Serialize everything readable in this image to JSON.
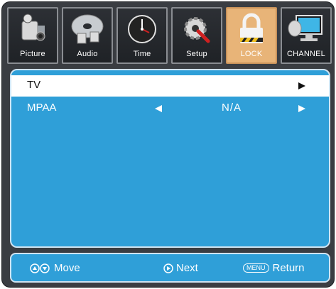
{
  "tabs": [
    {
      "label": "Picture",
      "icon": "camcorder-icon"
    },
    {
      "label": "Audio",
      "icon": "disc-icon"
    },
    {
      "label": "Time",
      "icon": "clock-icon"
    },
    {
      "label": "Setup",
      "icon": "gear-wrench-icon"
    },
    {
      "label": "LOCK",
      "icon": "padlock-icon",
      "active": true
    },
    {
      "label": "CHANNEL",
      "icon": "satellite-monitor-icon"
    }
  ],
  "rows": [
    {
      "label": "TV",
      "value": ""
    },
    {
      "label": "MPAA",
      "value": "N/A"
    }
  ],
  "bottom": {
    "move_label": "Move",
    "next_label": "Next",
    "menu_key": "MENU",
    "return_label": "Return"
  },
  "colors": {
    "panel": "#2f9fd8",
    "active_tab": "#e8b478",
    "frame": "#3a3d42"
  }
}
